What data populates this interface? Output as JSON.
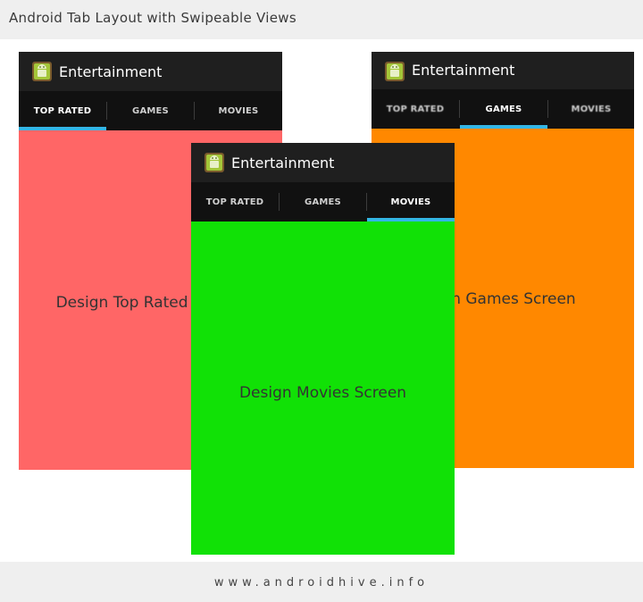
{
  "page_title": "Android Tab Layout with Swipeable Views",
  "footer": "www.androidhive.info",
  "app_title": "Entertainment",
  "tabs": [
    "TOP RATED",
    "GAMES",
    "MOVIES"
  ],
  "colors": {
    "top_rated": "#ff6666",
    "games": "#ff8800",
    "movies": "#11e106",
    "indicator": "#33b5e5"
  },
  "screens": {
    "top_rated": {
      "selected_tab": "TOP RATED",
      "content": "Design Top Rated Screen"
    },
    "games": {
      "selected_tab": "GAMES",
      "content": "Design Games Screen"
    },
    "movies": {
      "selected_tab": "MOVIES",
      "content": "Design Movies Screen"
    }
  },
  "icons": {
    "app_icon": "android-robot-icon"
  }
}
